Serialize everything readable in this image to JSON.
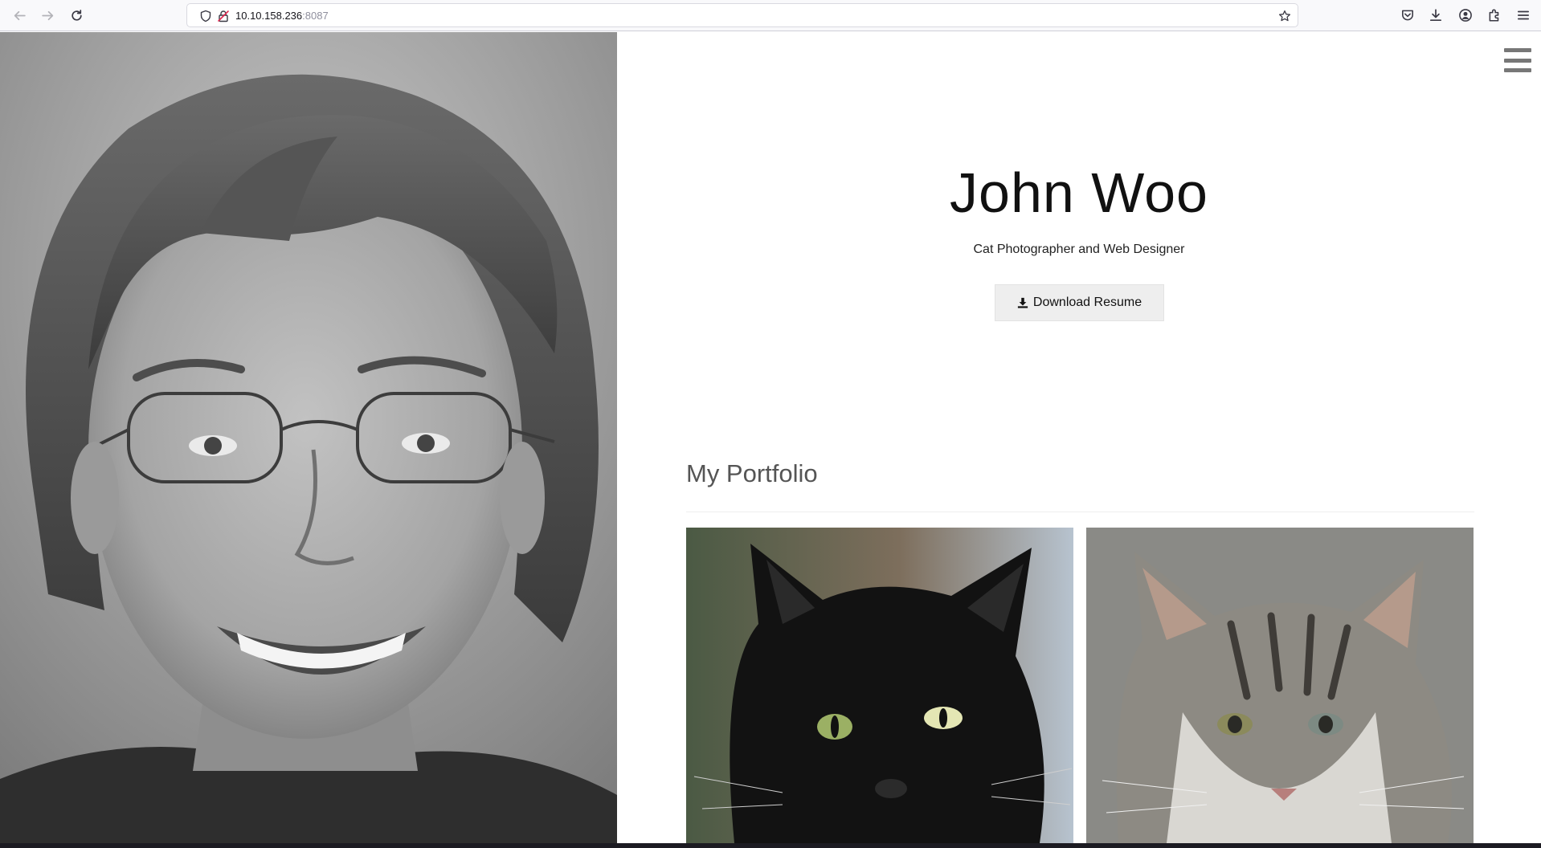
{
  "browser": {
    "url_host": "10.10.158.236",
    "url_port": ":8087",
    "back_icon": "back-arrow-icon",
    "forward_icon": "forward-arrow-icon",
    "reload_icon": "reload-icon",
    "toolbar_icons": [
      "pocket-icon",
      "download-icon",
      "account-icon",
      "extensions-icon",
      "menu-icon"
    ]
  },
  "hero": {
    "name": "John Woo",
    "subtitle": "Cat Photographer and Web Designer",
    "resume_button": "Download Resume"
  },
  "portfolio": {
    "title": "My Portfolio",
    "images": [
      {
        "description_icon": "black-cat-photo"
      },
      {
        "description_icon": "tabby-cat-photo"
      }
    ]
  },
  "colors": {
    "button_bg": "#eeeeee",
    "heading_text": "#111111",
    "portfolio_heading": "#555555",
    "hamburger": "#777777"
  }
}
